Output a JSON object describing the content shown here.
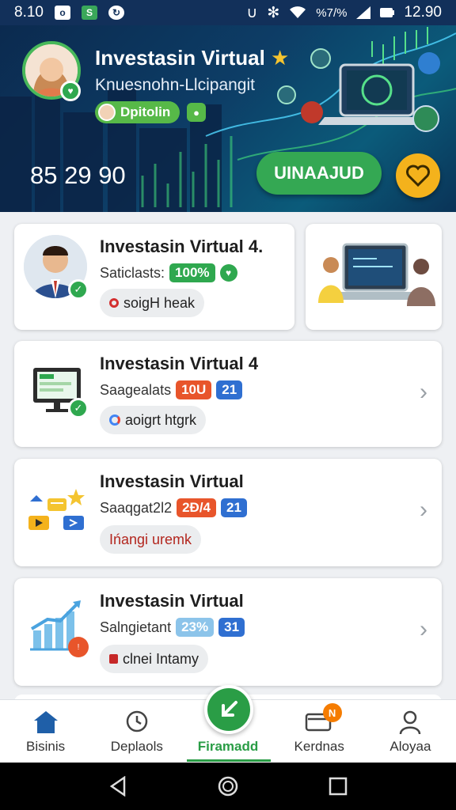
{
  "status_bar": {
    "time_left": "8.10",
    "battery_text": "%7/%",
    "time_right": "12.90"
  },
  "hero": {
    "title": "Investasin Virtual",
    "subtitle": "Knuesnohn-Llcipangit",
    "pill_label": "Dpitolin",
    "amount": "85 29 90",
    "action_button": "UINAAJUD"
  },
  "cards": [
    {
      "title": "Investasin Virtual 4.",
      "meta_label": "Saticlasts:",
      "badges": [
        {
          "text": "100%",
          "color": "#2fa84f"
        }
      ],
      "chip": "soigH heak"
    },
    {
      "title": "Investasin Virtual 4",
      "meta_label": "Saagealats",
      "badges": [
        {
          "text": "10U",
          "color": "#e8552b"
        },
        {
          "text": "21",
          "color": "#2f6fd1"
        }
      ],
      "chip": "aoigrt htgrk"
    },
    {
      "title": "Investasin Virtual",
      "meta_label": "Saaqgat2l2",
      "badges": [
        {
          "text": "2Ð/4",
          "color": "#e8552b"
        },
        {
          "text": "21",
          "color": "#2f6fd1"
        }
      ],
      "chip": "Ińangi uremk"
    },
    {
      "title": "Investasin Virtual",
      "meta_label": "Salngietant",
      "badges": [
        {
          "text": "23%",
          "color": "#8cc4ea"
        },
        {
          "text": "31",
          "color": "#2f6fd1"
        }
      ],
      "chip": "clnei Intamy"
    }
  ],
  "bottom_nav": [
    {
      "label": "Bisinis",
      "icon": "home-icon"
    },
    {
      "label": "Deplaols",
      "icon": "clock-icon"
    },
    {
      "label": "Firamadd",
      "icon": "arrow-icon"
    },
    {
      "label": "Kerdnas",
      "icon": "wallet-icon",
      "badge": "N"
    },
    {
      "label": "Aloyaa",
      "icon": "profile-icon"
    }
  ],
  "colors": {
    "primary": "#2a9d46",
    "hero_bg": "#0d3d66",
    "accent": "#f4b21c"
  }
}
